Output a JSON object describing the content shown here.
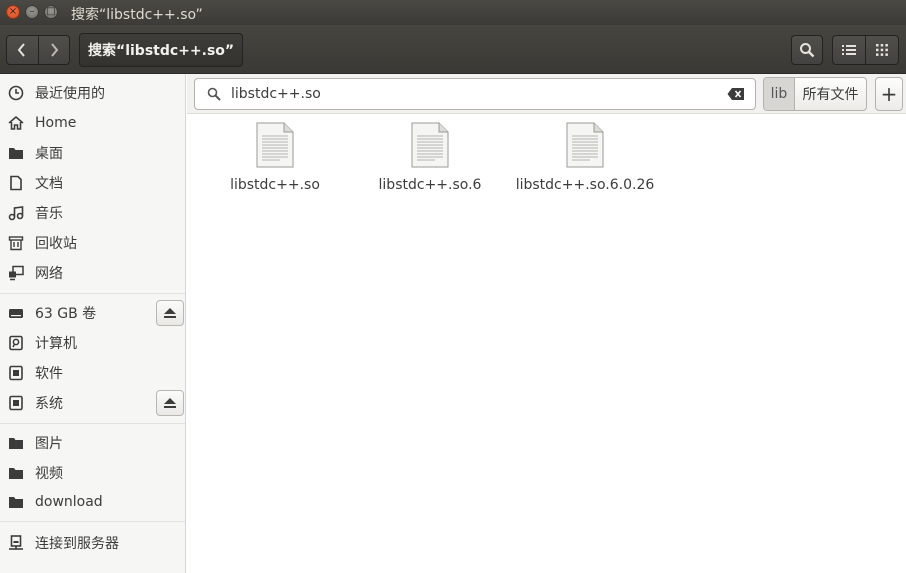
{
  "window": {
    "title": "搜索“libstdc++.so”",
    "close_glyph": "×",
    "min_glyph": "–",
    "max_glyph": "□"
  },
  "header": {
    "path_label": "搜索“libstdc++.so”"
  },
  "sidebar": {
    "items": [
      {
        "label": "最近使用的",
        "icon": "clock-icon"
      },
      {
        "label": "Home",
        "icon": "home-icon"
      },
      {
        "label": "桌面",
        "icon": "folder-icon"
      },
      {
        "label": "文档",
        "icon": "document-icon"
      },
      {
        "label": "音乐",
        "icon": "music-icon"
      },
      {
        "label": "回收站",
        "icon": "trash-icon"
      },
      {
        "label": "网络",
        "icon": "network-icon"
      },
      {
        "label": "63 GB 卷",
        "icon": "drive-icon"
      },
      {
        "label": "计算机",
        "icon": "computer-icon"
      },
      {
        "label": "软件",
        "icon": "chip-icon"
      },
      {
        "label": "系统",
        "icon": "chip-icon"
      },
      {
        "label": "图片",
        "icon": "folder-icon"
      },
      {
        "label": "视频",
        "icon": "folder-icon"
      },
      {
        "label": "download",
        "icon": "folder-icon"
      },
      {
        "label": "连接到服务器",
        "icon": "server-icon"
      }
    ]
  },
  "search": {
    "query": "libstdc++.so",
    "location_current": "lib",
    "location_all": "所有文件",
    "add_label": "+"
  },
  "files": [
    {
      "name": "libstdc++.so"
    },
    {
      "name": "libstdc++.so.6"
    },
    {
      "name": "libstdc++.so.6.0.26"
    }
  ]
}
